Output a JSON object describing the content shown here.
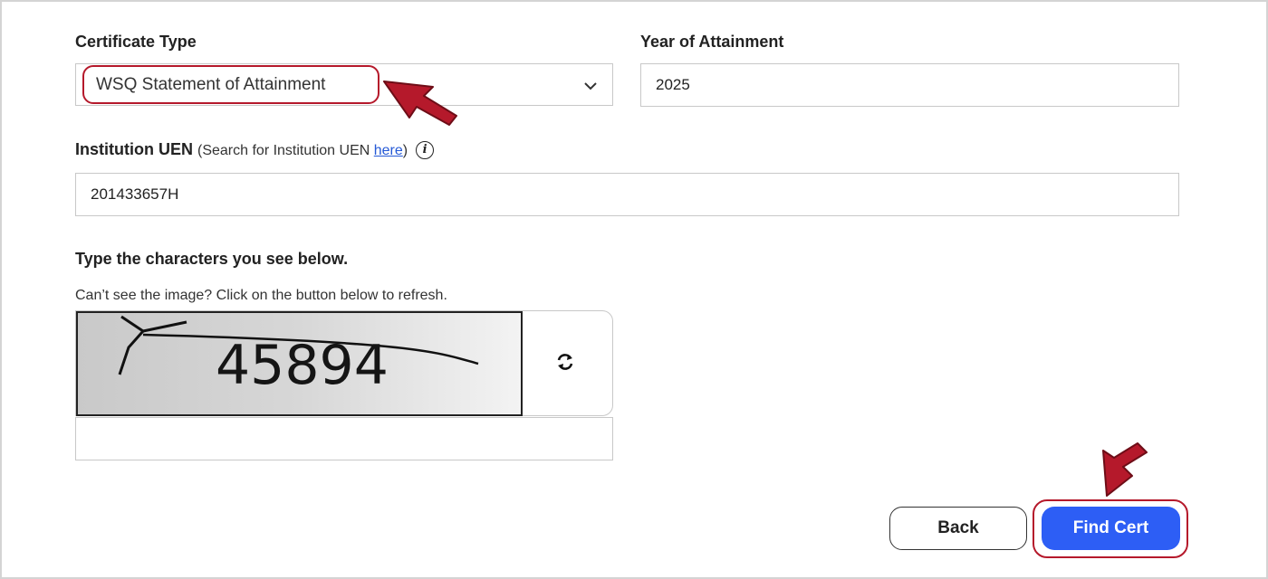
{
  "form": {
    "certificate_type": {
      "label": "Certificate Type",
      "selected": "WSQ Statement of Attainment"
    },
    "year": {
      "label": "Year of Attainment",
      "value": "2025"
    },
    "uen": {
      "label": "Institution UEN",
      "hint_prefix": "(Search for Institution UEN ",
      "hint_link": "here",
      "hint_suffix": ")",
      "info_icon": "i",
      "value": "201433657H"
    },
    "captcha": {
      "heading": "Type the characters you see below.",
      "note": "Can’t see the image? Click on the button below to refresh.",
      "image_text": "45894",
      "input_value": ""
    }
  },
  "buttons": {
    "back": "Back",
    "find": "Find Cert"
  },
  "icons": {
    "select": "chevron-down-icon",
    "info": "info-icon",
    "refresh": "refresh-icon",
    "pointer": "arrow-pointer-icon"
  },
  "colors": {
    "primary": "#2d5ef5",
    "highlight": "#b5192b",
    "link": "#2559d6"
  }
}
